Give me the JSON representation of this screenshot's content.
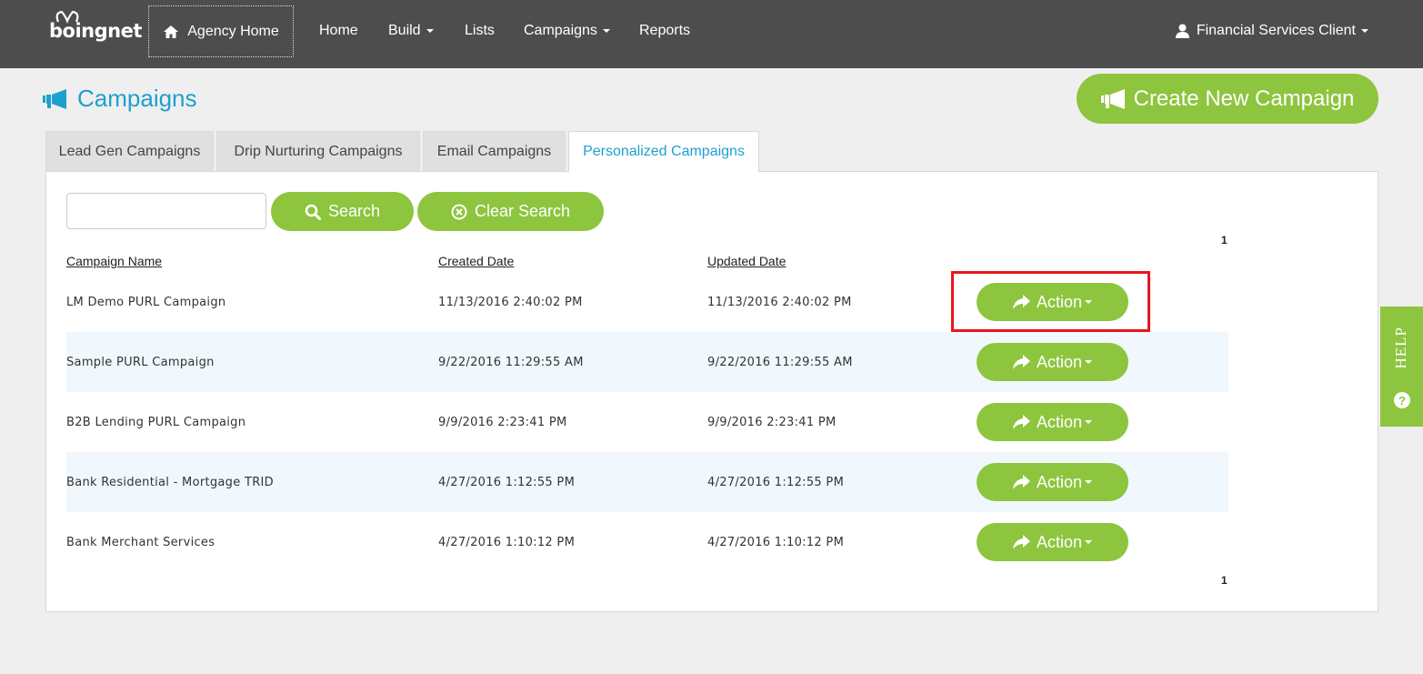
{
  "brand": {
    "logo_text": "boingnet"
  },
  "nav": {
    "agency_home": "Agency Home",
    "items": [
      {
        "label": "Home",
        "dropdown": false
      },
      {
        "label": "Build",
        "dropdown": true
      },
      {
        "label": "Lists",
        "dropdown": false
      },
      {
        "label": "Campaigns",
        "dropdown": true
      },
      {
        "label": "Reports",
        "dropdown": false
      }
    ],
    "user": "Financial Services Client"
  },
  "page": {
    "title": "Campaigns",
    "create_button": "Create New Campaign"
  },
  "tabs": [
    {
      "label": "Lead Gen Campaigns",
      "active": false
    },
    {
      "label": "Drip Nurturing Campaigns",
      "active": false
    },
    {
      "label": "Email Campaigns",
      "active": false
    },
    {
      "label": "Personalized Campaigns",
      "active": true
    }
  ],
  "search": {
    "value": "",
    "placeholder": "",
    "search_button": "Search",
    "clear_button": "Clear Search"
  },
  "pager": {
    "top": "1",
    "bottom": "1"
  },
  "table": {
    "columns": [
      "Campaign Name",
      "Created Date",
      "Updated Date"
    ],
    "action_label": "Action",
    "rows": [
      {
        "name": "LM Demo PURL Campaign",
        "created": "11/13/2016 2:40:02 PM",
        "updated": "11/13/2016 2:40:02 PM"
      },
      {
        "name": "Sample PURL Campaign",
        "created": "9/22/2016 11:29:55 AM",
        "updated": "9/22/2016 11:29:55 AM"
      },
      {
        "name": "B2B Lending PURL Campaign",
        "created": "9/9/2016 2:23:41 PM",
        "updated": "9/9/2016 2:23:41 PM"
      },
      {
        "name": "Bank Residential - Mortgage TRID",
        "created": "4/27/2016 1:12:55 PM",
        "updated": "4/27/2016 1:12:55 PM"
      },
      {
        "name": "Bank Merchant Services",
        "created": "4/27/2016 1:10:12 PM",
        "updated": "4/27/2016 1:10:12 PM"
      }
    ]
  },
  "help": {
    "label": "HELP",
    "icon_glyph": "?"
  },
  "colors": {
    "navbar": "#4d4d4d",
    "accent_green": "#8dc53e",
    "title_blue": "#1ea0cf",
    "row_alt": "#f1f8fd",
    "highlight_red": "#e8161b"
  }
}
